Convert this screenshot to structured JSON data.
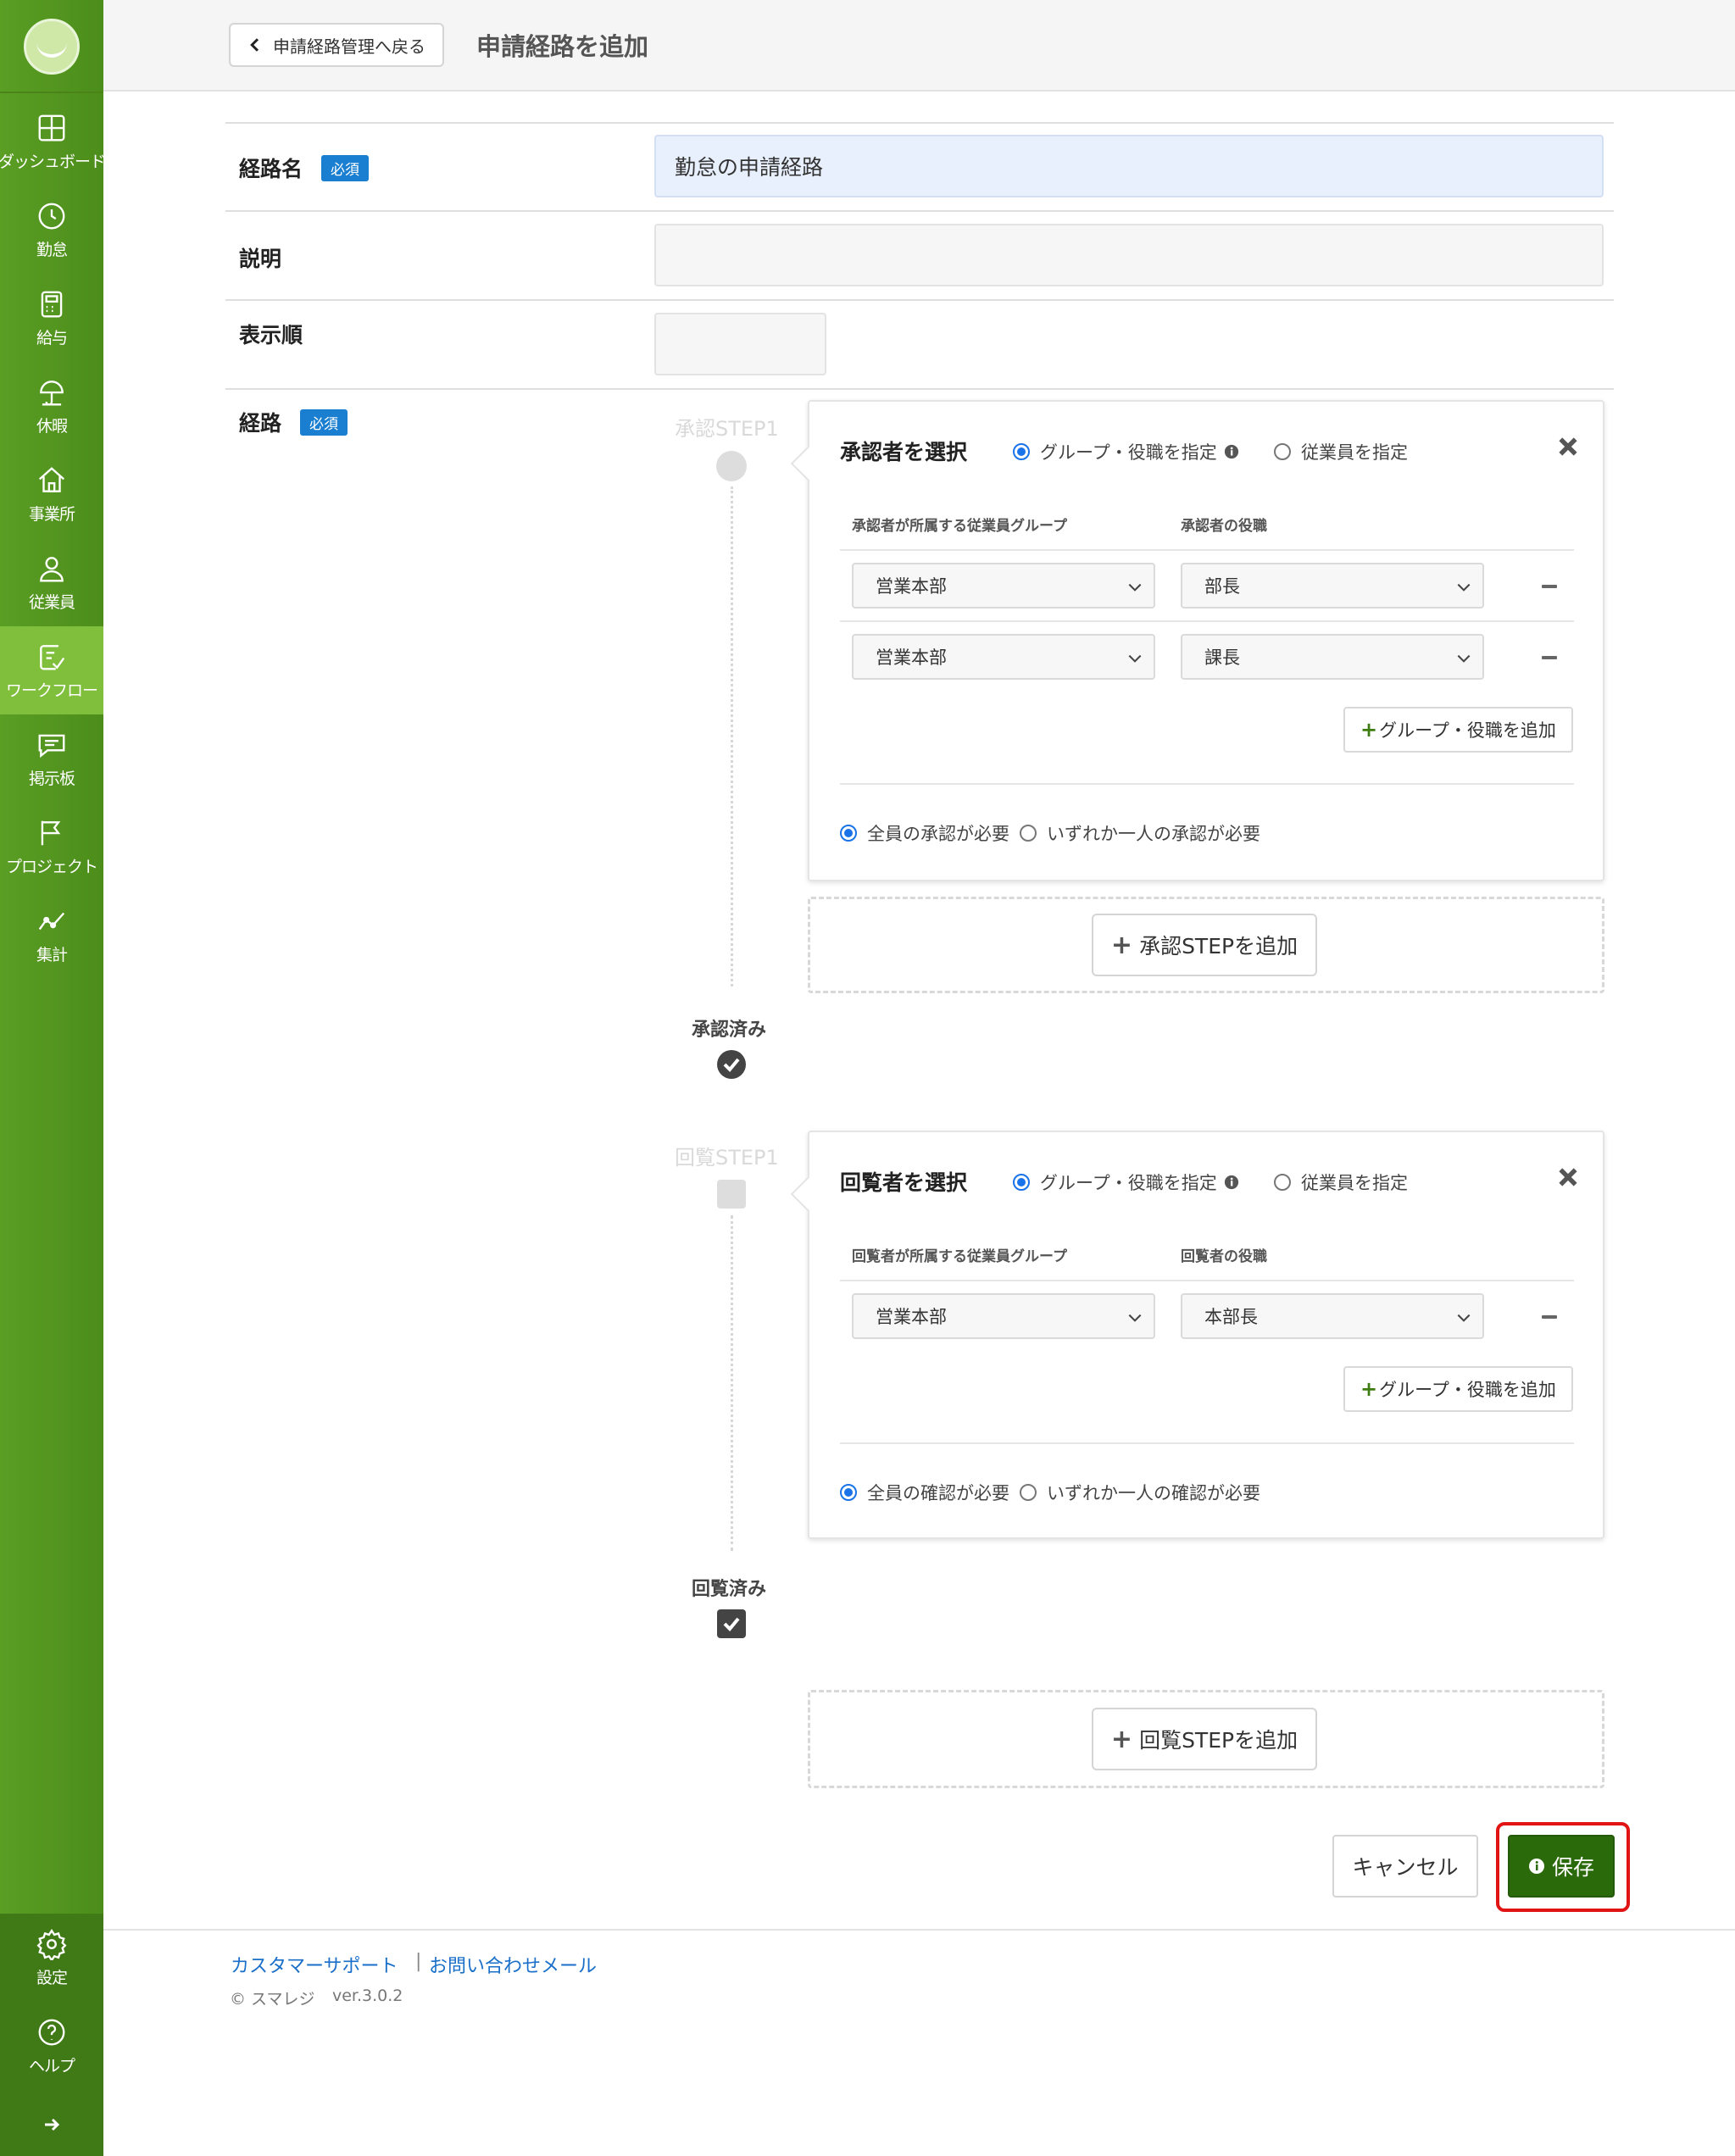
{
  "sidebar": {
    "items": [
      {
        "label": "ダッシュボード",
        "icon": "dashboard-icon"
      },
      {
        "label": "勤怠",
        "icon": "clock-icon"
      },
      {
        "label": "給与",
        "icon": "calculator-icon"
      },
      {
        "label": "休暇",
        "icon": "umbrella-icon"
      },
      {
        "label": "事業所",
        "icon": "home-icon"
      },
      {
        "label": "従業員",
        "icon": "person-icon"
      },
      {
        "label": "ワークフロー",
        "icon": "workflow-icon",
        "active": true
      },
      {
        "label": "掲示板",
        "icon": "chat-icon"
      },
      {
        "label": "プロジェクト",
        "icon": "flag-icon"
      },
      {
        "label": "集計",
        "icon": "chart-icon"
      }
    ],
    "bottom": [
      {
        "label": "設定",
        "icon": "gear-icon"
      },
      {
        "label": "ヘルプ",
        "icon": "help-icon"
      }
    ],
    "colors": {
      "base": "#5a9e24",
      "active": "#7fbf3c",
      "bottom": "#3f7a16"
    }
  },
  "header": {
    "back_label": "申請経路管理へ戻る",
    "title": "申請経路を追加"
  },
  "form": {
    "route_name_label": "経路名",
    "required_badge": "必須",
    "route_name_value": "勤怠の申請経路",
    "description_label": "説明",
    "description_value": "",
    "order_label": "表示順",
    "order_value": "",
    "route_label": "経路"
  },
  "approval_step": {
    "step_label": "承認STEP1",
    "card_title": "承認者を選択",
    "mode_group": "グループ・役職を指定",
    "mode_employee": "従業員を指定",
    "col_group": "承認者が所属する従業員グループ",
    "col_role": "承認者の役職",
    "rows": [
      {
        "group": "営業本部",
        "role": "部長"
      },
      {
        "group": "営業本部",
        "role": "課長"
      }
    ],
    "add_group_label": "グループ・役職を追加",
    "all_required": "全員の承認が必要",
    "any_one": "いずれか一人の承認が必要",
    "add_step_label": "承認STEPを追加",
    "done_label": "承認済み"
  },
  "review_step": {
    "step_label": "回覧STEP1",
    "card_title": "回覧者を選択",
    "mode_group": "グループ・役職を指定",
    "mode_employee": "従業員を指定",
    "col_group": "回覧者が所属する従業員グループ",
    "col_role": "回覧者の役職",
    "rows": [
      {
        "group": "営業本部",
        "role": "本部長"
      }
    ],
    "add_group_label": "グループ・役職を追加",
    "all_required": "全員の確認が必要",
    "any_one": "いずれか一人の確認が必要",
    "add_step_label": "回覧STEPを追加",
    "done_label": "回覧済み"
  },
  "actions": {
    "cancel": "キャンセル",
    "save": "保存"
  },
  "footer": {
    "support_link": "カスタマーサポート",
    "separator": "|",
    "mail_link": "お問い合わせメール",
    "copyright": "© スマレジ",
    "version": "ver.3.0.2"
  }
}
